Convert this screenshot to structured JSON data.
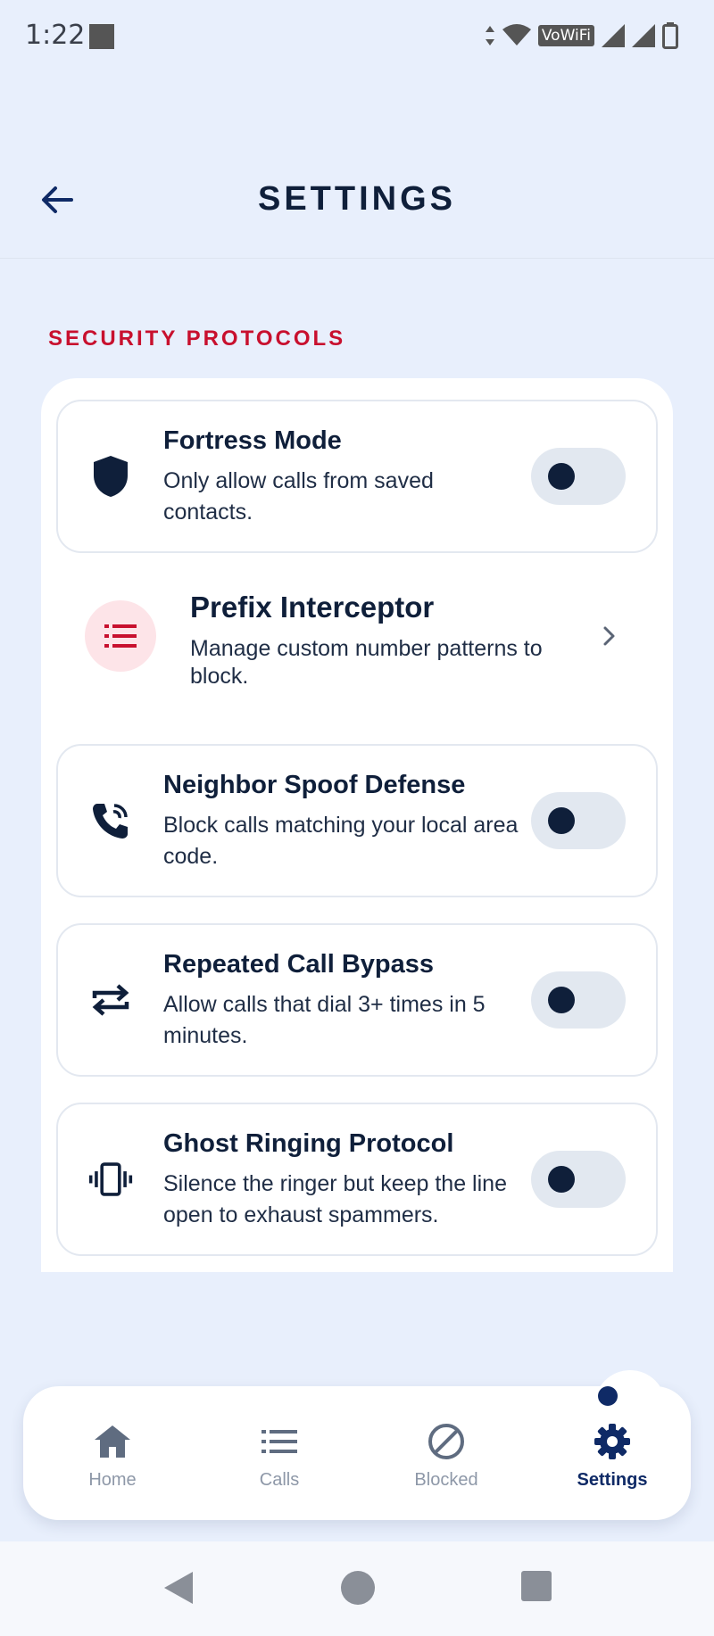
{
  "status_bar": {
    "time": "1:22",
    "network_label": "VoWiFi"
  },
  "header": {
    "title": "SETTINGS",
    "back_icon": "arrow-left-icon"
  },
  "section": {
    "label": "SECURITY PROTOCOLS"
  },
  "settings": [
    {
      "title": "Fortress Mode",
      "description": "Only allow calls from saved contacts.",
      "icon": "shield-icon",
      "enabled": false
    },
    {
      "title": "Prefix Interceptor",
      "description": "Manage custom number patterns to block.",
      "icon": "list-icon"
    },
    {
      "title": "Neighbor Spoof Defense",
      "description": "Block calls matching your local area code.",
      "icon": "phone-ringing-icon",
      "enabled": false
    },
    {
      "title": "Repeated Call Bypass",
      "description": "Allow calls that dial 3+ times in 5 minutes.",
      "icon": "repeat-icon",
      "enabled": false
    },
    {
      "title": "Ghost Ringing Protocol",
      "description": "Silence the ringer but keep the line open to exhaust spammers.",
      "icon": "vibrate-icon",
      "enabled": false
    }
  ],
  "bottom_nav": {
    "items": [
      {
        "label": "Home",
        "icon": "home-icon"
      },
      {
        "label": "Calls",
        "icon": "list-icon"
      },
      {
        "label": "Blocked",
        "icon": "block-icon"
      },
      {
        "label": "Settings",
        "icon": "gear-icon",
        "active": true
      }
    ]
  },
  "colors": {
    "background": "#e8effc",
    "primary_text": "#0f1f3a",
    "accent_red": "#c8102e",
    "active_nav": "#0f2a66",
    "inactive_nav": "#8e98a8",
    "toggle_track": "#e2e8f0"
  }
}
